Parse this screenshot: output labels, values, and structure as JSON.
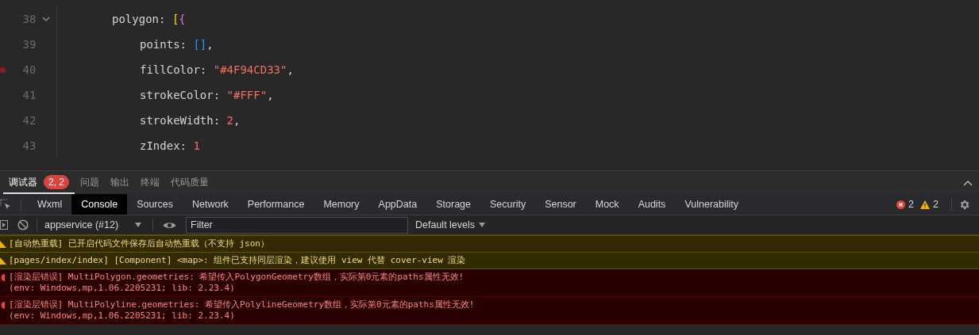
{
  "editor": {
    "lines": [
      {
        "number": "38",
        "foldable": true,
        "breakpoint": false,
        "tokens": [
          {
            "text": "polygon",
            "kind": "key"
          },
          {
            "text": ": ",
            "kind": "punct"
          },
          {
            "text": "[",
            "kind": "bracket-outer"
          },
          {
            "text": "{",
            "kind": "bracket-inner"
          }
        ],
        "children": [
          {
            "number": "39",
            "foldable": false,
            "breakpoint": false,
            "tokens": [
              {
                "text": "points",
                "kind": "key"
              },
              {
                "text": ": ",
                "kind": "punct"
              },
              {
                "text": "[]",
                "kind": "bracket-empty"
              },
              {
                "text": ",",
                "kind": "punct"
              }
            ]
          },
          {
            "number": "40",
            "foldable": false,
            "breakpoint": true,
            "tokens": [
              {
                "text": "fillColor",
                "kind": "key"
              },
              {
                "text": ": ",
                "kind": "punct"
              },
              {
                "text": "\"#4F94CD33\"",
                "kind": "string"
              },
              {
                "text": ",",
                "kind": "punct"
              }
            ]
          },
          {
            "number": "41",
            "foldable": false,
            "breakpoint": false,
            "tokens": [
              {
                "text": "strokeColor",
                "kind": "key"
              },
              {
                "text": ": ",
                "kind": "punct"
              },
              {
                "text": "\"#FFF\"",
                "kind": "string"
              },
              {
                "text": ",",
                "kind": "punct"
              }
            ]
          },
          {
            "number": "42",
            "foldable": false,
            "breakpoint": false,
            "tokens": [
              {
                "text": "strokeWidth",
                "kind": "key"
              },
              {
                "text": ": ",
                "kind": "punct"
              },
              {
                "text": "2",
                "kind": "number"
              },
              {
                "text": ",",
                "kind": "punct"
              }
            ]
          },
          {
            "number": "43",
            "foldable": false,
            "breakpoint": false,
            "tokens": [
              {
                "text": "zIndex",
                "kind": "key"
              },
              {
                "text": ": ",
                "kind": "punct"
              },
              {
                "text": "1",
                "kind": "number"
              }
            ]
          }
        ]
      }
    ]
  },
  "panel_tabs": [
    {
      "label": "调试器",
      "selected": true,
      "badge": "2, 2"
    },
    {
      "label": "问题",
      "selected": false
    },
    {
      "label": "输出",
      "selected": false
    },
    {
      "label": "终端",
      "selected": false
    },
    {
      "label": "代码质量",
      "selected": false
    }
  ],
  "devtools_tabs": [
    {
      "label": "Wxml",
      "selected": false
    },
    {
      "label": "Console",
      "selected": true
    },
    {
      "label": "Sources",
      "selected": false
    },
    {
      "label": "Network",
      "selected": false
    },
    {
      "label": "Performance",
      "selected": false
    },
    {
      "label": "Memory",
      "selected": false
    },
    {
      "label": "AppData",
      "selected": false
    },
    {
      "label": "Storage",
      "selected": false
    },
    {
      "label": "Security",
      "selected": false
    },
    {
      "label": "Sensor",
      "selected": false
    },
    {
      "label": "Mock",
      "selected": false
    },
    {
      "label": "Audits",
      "selected": false
    },
    {
      "label": "Vulnerability",
      "selected": false
    }
  ],
  "counts": {
    "errors": "2",
    "warnings": "2"
  },
  "toolbar": {
    "context": "appservice (#12)",
    "filter_placeholder": "Filter",
    "levels": "Default levels"
  },
  "messages": [
    {
      "kind": "warning",
      "lines": [
        "[自动热重载] 已开启代码文件保存后自动热重载（不支持 json）"
      ]
    },
    {
      "kind": "warning",
      "lines": [
        "[pages/index/index] [Component] <map>: 组件已支持同层渲染，建议使用 view 代替 cover-view 渲染"
      ]
    },
    {
      "kind": "error",
      "lines": [
        "[渲染层错误] MultiPolygon.geometries: 希望传入PolygonGeometry数组，实际第0元素的paths属性无效!",
        "(env: Windows,mp,1.06.2205231; lib: 2.23.4)"
      ]
    },
    {
      "kind": "error",
      "lines": [
        "[渲染层错误] MultiPolyline.geometries: 希望传入PolylineGeometry数组，实际第0元素的paths属性无效!",
        "(env: Windows,mp,1.06.2205231; lib: 2.23.4)"
      ]
    }
  ]
}
